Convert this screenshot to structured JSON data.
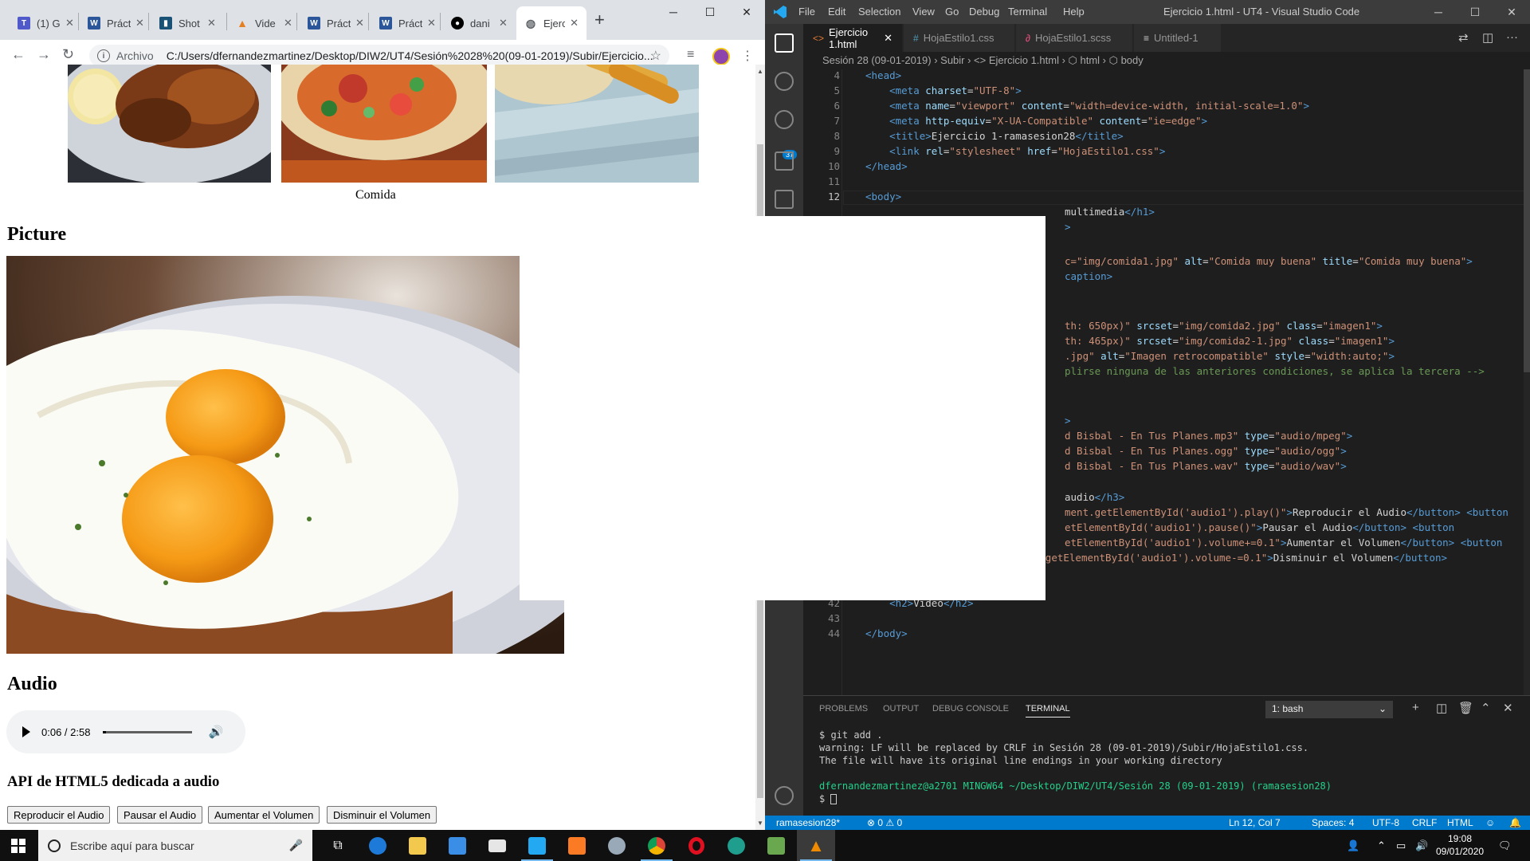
{
  "chrome": {
    "tabs": [
      {
        "title": "(1) G",
        "icon": "teams-icon",
        "color": "#5059c9"
      },
      {
        "title": "Práct",
        "icon": "word-icon",
        "color": "#2b579a"
      },
      {
        "title": "Shot",
        "icon": "sheet-icon",
        "color": "#1a5276"
      },
      {
        "title": "Vide",
        "icon": "vlc-icon",
        "color": "#e67e22"
      },
      {
        "title": "Práct",
        "icon": "word-icon",
        "color": "#2b579a"
      },
      {
        "title": "Práct",
        "icon": "word-icon",
        "color": "#2b579a"
      },
      {
        "title": "dani",
        "icon": "github-icon",
        "color": "#000000"
      },
      {
        "title": "Ejerc",
        "icon": "globe-icon",
        "color": "#5f6368"
      }
    ],
    "address_scheme": "Archivo",
    "address_url": "C:/Users/dfernandezmartinez/Desktop/DIW2/UT4/Sesión%2028%20(09-01-2019)/Subir/Ejercicio..."
  },
  "page": {
    "figcaption": "Comida",
    "picture_heading": "Picture",
    "audio_heading": "Audio",
    "audio_player": {
      "time": "0:06 / 2:58",
      "progress": 0.034
    },
    "api_heading": "API de HTML5 dedicada a audio",
    "buttons": [
      "Reproducir el Audio",
      "Pausar el Audio",
      "Aumentar el Volumen",
      "Disminuir el Volumen"
    ]
  },
  "vscode": {
    "menu": [
      "File",
      "Edit",
      "Selection",
      "View",
      "Go",
      "Debug",
      "Terminal",
      "Help"
    ],
    "title": "Ejercicio 1.html - UT4 - Visual Studio Code",
    "tabs": [
      {
        "label": "Ejercicio 1.html",
        "icon": "<>",
        "active": true
      },
      {
        "label": "HojaEstilo1.css",
        "icon": "#",
        "active": false
      },
      {
        "label": "HojaEstilo1.scss",
        "icon": "∂",
        "active": false
      },
      {
        "label": "Untitled-1",
        "icon": "≡",
        "active": false
      }
    ],
    "breadcrumb": "Sesión 28 (09-01-2019) › Subir › <> Ejercicio 1.html › ⬡ html › ⬡ body",
    "scm_badge": "37",
    "panel_tabs": [
      "PROBLEMS",
      "OUTPUT",
      "DEBUG CONSOLE",
      "TERMINAL"
    ],
    "terminal_select": "1: bash",
    "terminal": [
      "$ git add .",
      "warning: LF will be replaced by CRLF in Sesión 28 (09-01-2019)/Subir/HojaEstilo1.css.",
      "The file will have its original line endings in your working directory",
      "",
      "dfernandezmartinez@a2701 MINGW64 ~/Desktop/DIW2/UT4/Sesión 28 (09-01-2019) (ramasesion28)",
      "$ "
    ],
    "status": {
      "branch": "ramasesion28*",
      "problems": "⊗ 0 ⚠ 0",
      "position": "Ln 12, Col 7",
      "spaces": "Spaces: 4",
      "encoding": "UTF-8",
      "eol": "CRLF",
      "language": "HTML"
    }
  },
  "taskbar": {
    "search_placeholder": "Escribe aquí para buscar",
    "time": "19:08",
    "date": "09/01/2020"
  }
}
